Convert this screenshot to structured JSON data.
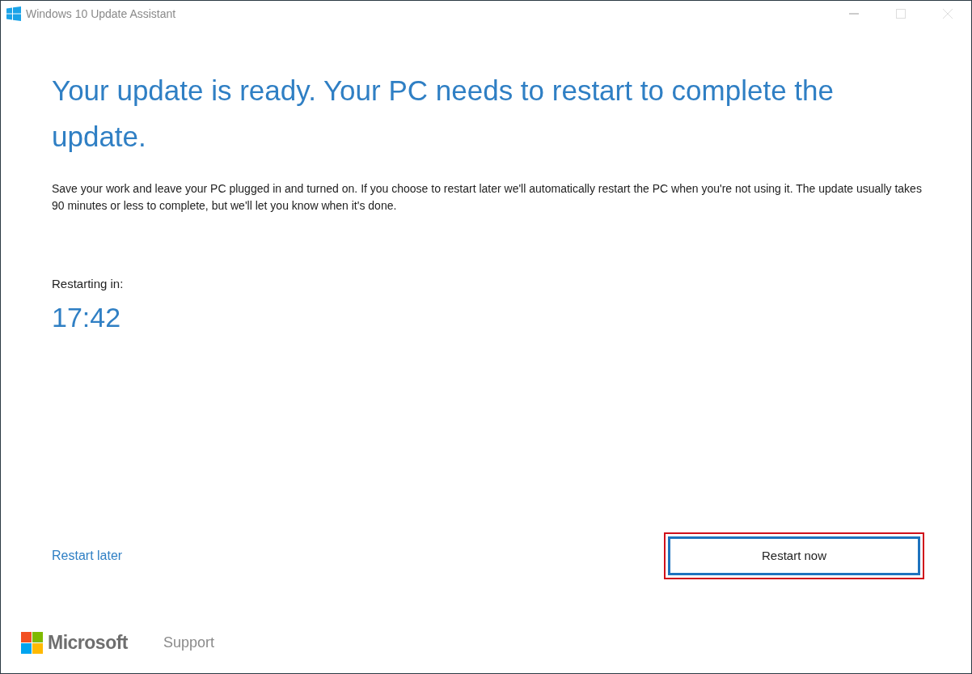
{
  "window": {
    "title": "Windows 10 Update Assistant"
  },
  "heading": "Your update is ready. Your PC needs to restart to complete the update.",
  "message": "Save your work and leave your PC plugged in and turned on. If you choose to restart later we'll automatically restart the PC when you're not using it. The update usually takes 90 minutes or less to complete, but we'll let you know when it's done.",
  "countdown": {
    "label": "Restarting in:",
    "time": "17:42"
  },
  "restart_later": "Restart later",
  "restart_now": {
    "label": "Restart now",
    "highlighted": true
  },
  "footer": {
    "brand": "Microsoft",
    "support": "Support"
  }
}
